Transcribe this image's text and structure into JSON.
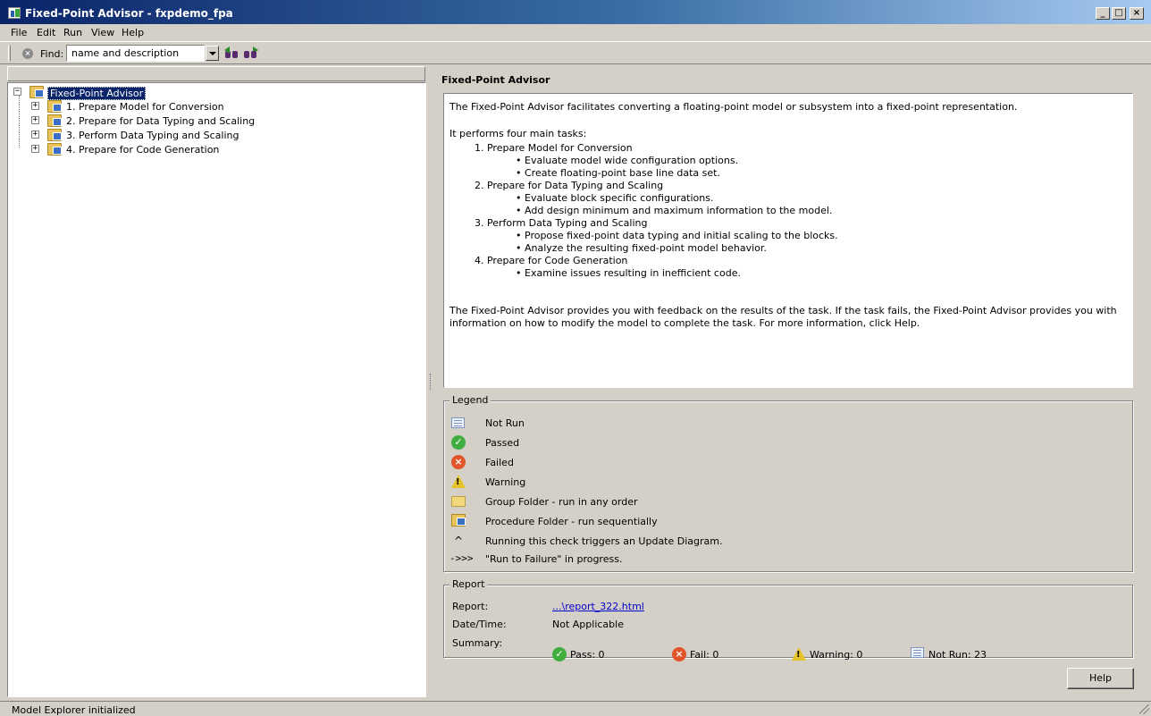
{
  "window": {
    "title": "Fixed-Point Advisor - fxpdemo_fpa",
    "minimize": "_",
    "maximize": "□",
    "close": "×"
  },
  "menu": [
    "File",
    "Edit",
    "Run",
    "View",
    "Help"
  ],
  "toolbar": {
    "find_label": "Find:",
    "find_value": "name and description"
  },
  "tree": {
    "root": "Fixed-Point Advisor",
    "items": [
      "1. Prepare Model for Conversion",
      "2. Prepare for Data Typing and Scaling",
      "3. Perform Data Typing and Scaling",
      "4. Prepare for Code Generation"
    ]
  },
  "detail": {
    "title": "Fixed-Point Advisor",
    "intro": "The Fixed-Point Advisor facilitates converting a floating-point model or subsystem into a fixed-point representation.",
    "tasks_heading": "It performs four main tasks:",
    "tasks": [
      {
        "name": "1. Prepare Model for Conversion",
        "bullets": [
          "Evaluate model wide configuration options.",
          "Create floating-point base line data set."
        ]
      },
      {
        "name": "2. Prepare for Data Typing and Scaling",
        "bullets": [
          "Evaluate block specific configurations.",
          "Add design minimum and maximum information to the model."
        ]
      },
      {
        "name": "3. Perform Data Typing and Scaling",
        "bullets": [
          "Propose fixed-point data typing and initial scaling to the blocks.",
          "Analyze the resulting fixed-point model behavior."
        ]
      },
      {
        "name": "4. Prepare for Code Generation",
        "bullets": [
          "Examine issues resulting in inefficient code."
        ]
      }
    ],
    "footer": "The Fixed-Point Advisor provides you with feedback on the results of the task. If the task fails, the Fixed-Point Advisor provides you with information on how to modify the model to complete the task. For more information, click Help."
  },
  "legend": {
    "title": "Legend",
    "items": [
      {
        "icon": "not-run-icon",
        "label": "Not Run"
      },
      {
        "icon": "passed-icon",
        "label": "Passed"
      },
      {
        "icon": "failed-icon",
        "label": "Failed"
      },
      {
        "icon": "warning-icon",
        "label": "Warning"
      },
      {
        "icon": "group-folder-icon",
        "label": "Group Folder - run in any order"
      },
      {
        "icon": "procedure-folder-icon",
        "label": "Procedure Folder - run sequentially"
      },
      {
        "icon": "caret-icon",
        "glyph": "^",
        "label": "Running this check triggers an Update Diagram."
      },
      {
        "icon": "arrow-icon",
        "glyph": "->>>",
        "label": "\"Run to Failure\" in progress."
      }
    ]
  },
  "report": {
    "title": "Report",
    "report_label": "Report:",
    "report_link": "...\\report_322.html",
    "datetime_label": "Date/Time:",
    "datetime_value": "Not Applicable",
    "summary_label": "Summary:",
    "pass": "Pass: 0",
    "fail": "Fail: 0",
    "warning": "Warning: 0",
    "not_run": "Not Run: 23"
  },
  "help_button": "Help",
  "status": "Model Explorer initialized"
}
